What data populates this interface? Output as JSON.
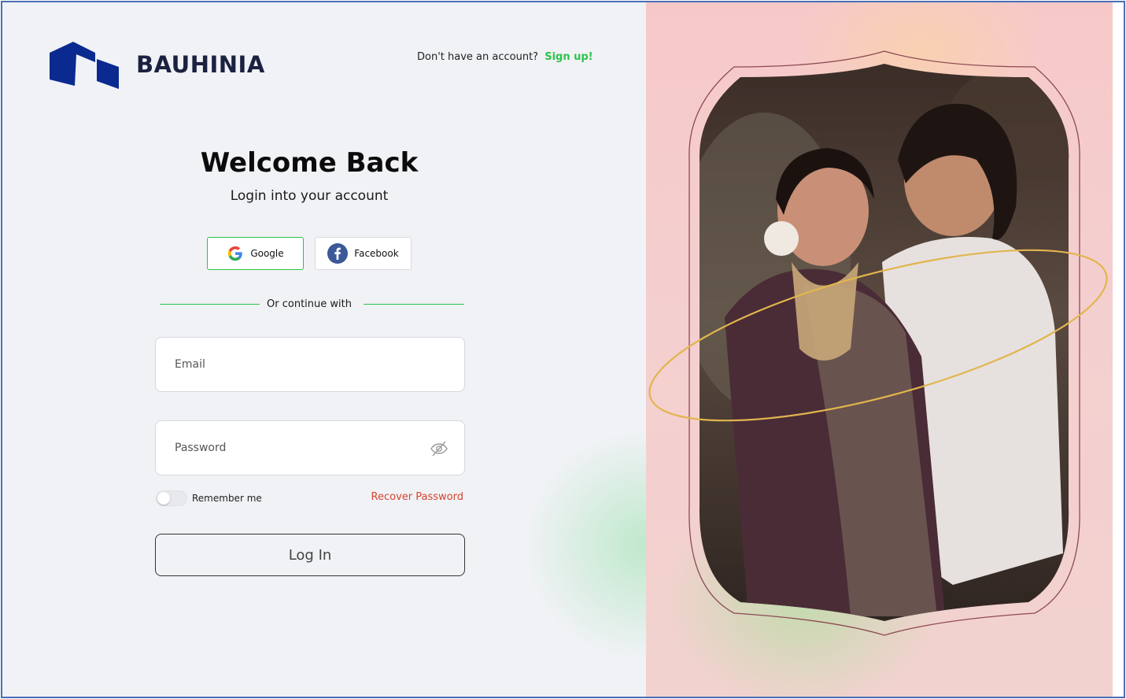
{
  "brand": {
    "name": "BAUHINIA",
    "color": "#0a2a8f"
  },
  "header": {
    "no_account_text": "Don't have an account?",
    "signup_label": "Sign up!"
  },
  "login": {
    "title": "Welcome Back",
    "subtitle": "Login into your account",
    "social": {
      "google_label": "Google",
      "facebook_label": "Facebook"
    },
    "divider_text": "Or continue with",
    "email_placeholder": "Email",
    "password_placeholder": "Password",
    "remember_label": "Remember me",
    "recover_label": "Recover Password",
    "login_label": "Log In"
  },
  "colors": {
    "accent_green": "#2cc34a",
    "recover_red": "#d4452f",
    "panel_pink": "#f6c9c8",
    "ring_gold": "#e2b54e"
  },
  "icons": [
    "google-icon",
    "facebook-icon",
    "eye-off-icon"
  ]
}
